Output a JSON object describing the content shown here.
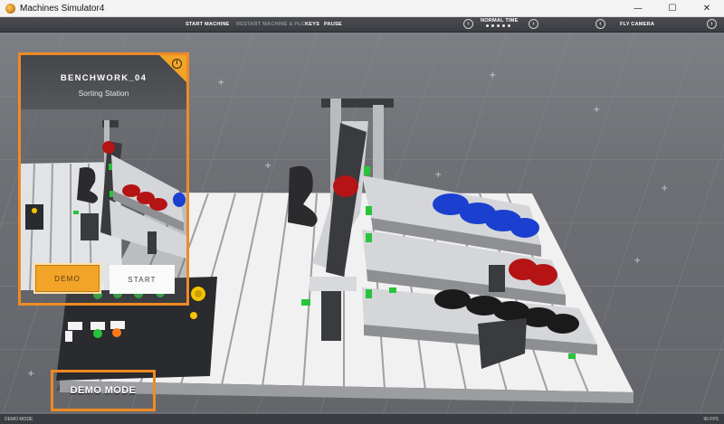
{
  "window": {
    "title": "Machines Simulator4",
    "minimize": "—",
    "maximize": "☐",
    "close": "✕"
  },
  "toolbar": {
    "start_machine": "START MACHINE",
    "restart_machine": "RESTART MACHINE & PLC",
    "keys": "KEYS",
    "pause": "PAUSE",
    "time_label": "NORMAL TIME",
    "time_level": 5,
    "prev": "‹",
    "next": "›",
    "fly_camera": "FLY CAMERA",
    "camera_prev": "‹",
    "camera_next": "›"
  },
  "panel": {
    "title": "BENCHWORK_04",
    "subtitle": "Sorting Station",
    "info_icon": "i",
    "demo_button": "DEMO",
    "start_button": "START"
  },
  "overlay": {
    "demo_mode": "DEMO MODE"
  },
  "status": {
    "left": "DEMO MODE",
    "right": "90 FPS"
  },
  "colors": {
    "accent": "#f08a25",
    "button_orange": "#f1a428",
    "green_indicator": "#27c43a",
    "red_part": "#c71818",
    "blue_part": "#1b3fcf",
    "black_part": "#1a1a1a"
  }
}
